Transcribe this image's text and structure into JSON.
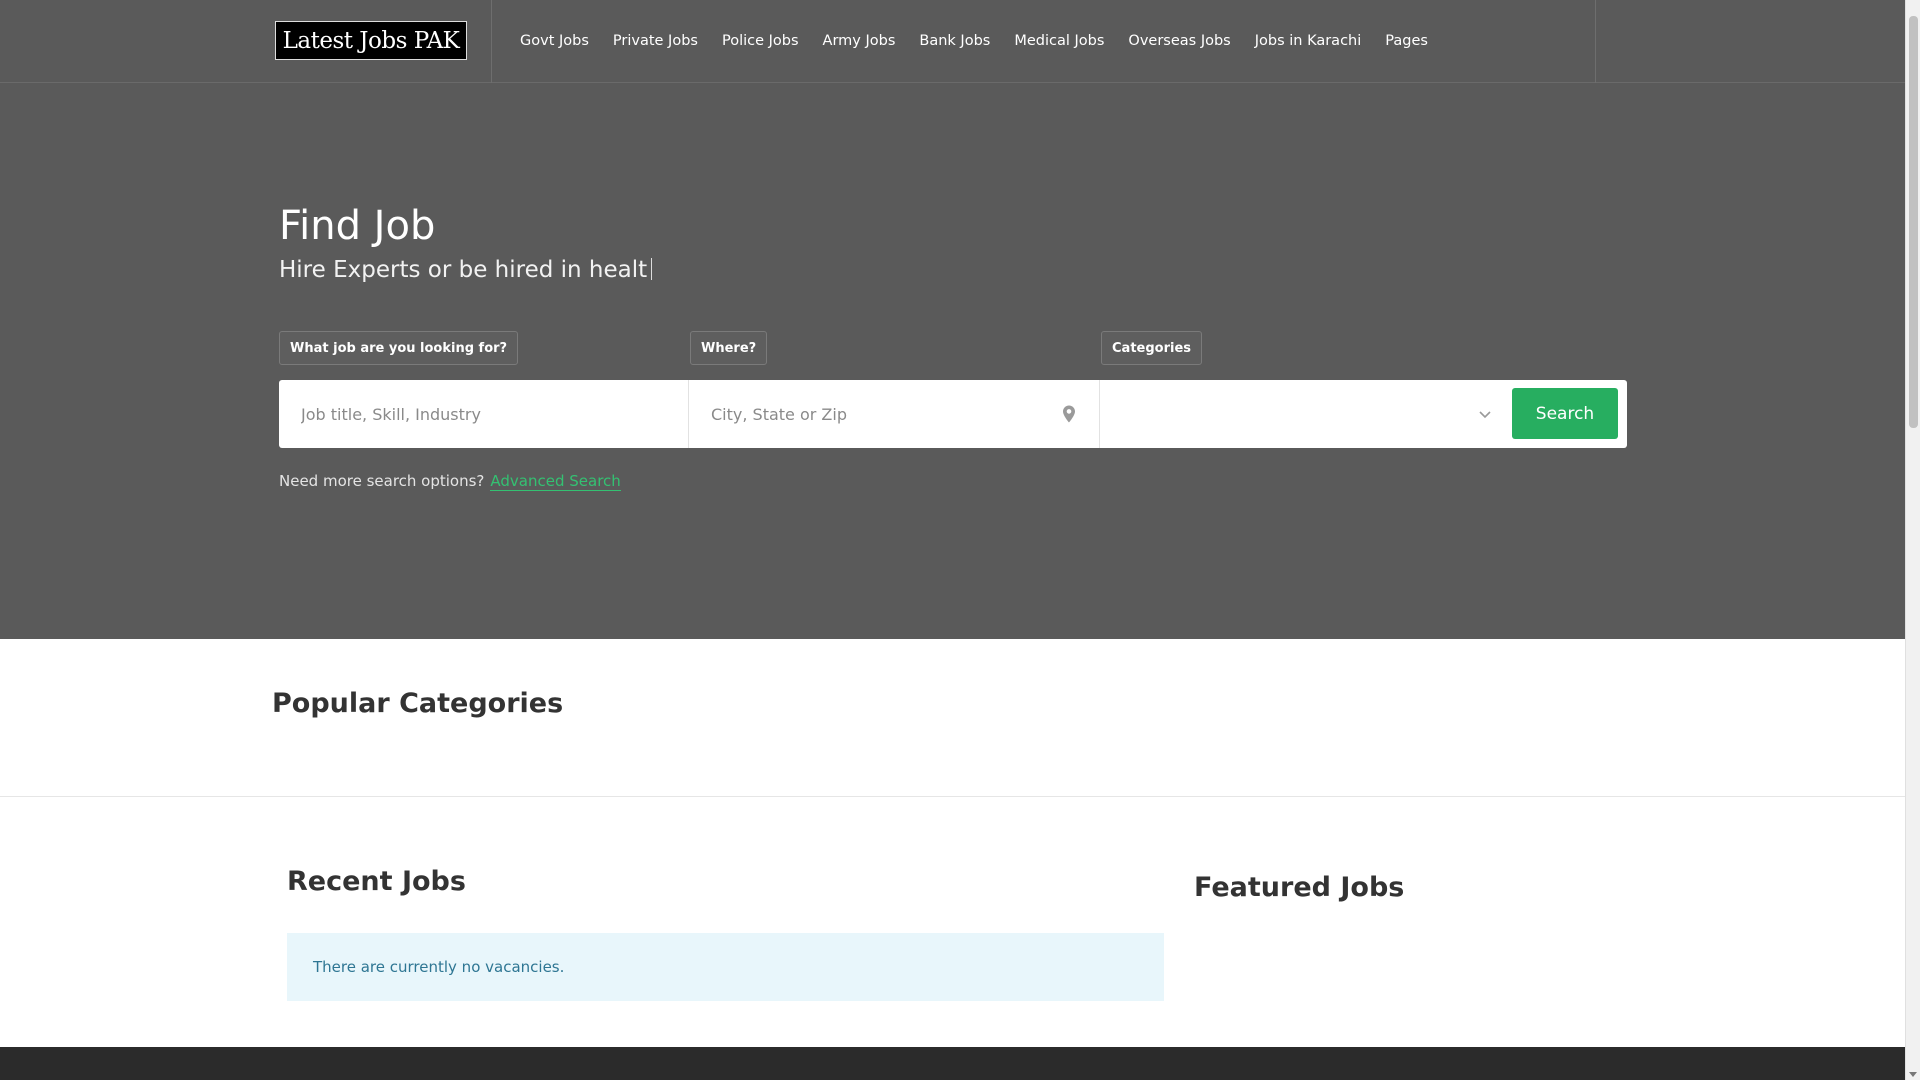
{
  "header": {
    "logo_text": "Latest Jobs PAK",
    "nav": [
      {
        "label": "Govt Jobs"
      },
      {
        "label": "Private Jobs"
      },
      {
        "label": "Police Jobs"
      },
      {
        "label": "Army Jobs"
      },
      {
        "label": "Bank Jobs"
      },
      {
        "label": "Medical Jobs"
      },
      {
        "label": "Overseas Jobs"
      },
      {
        "label": "Jobs in Karachi"
      },
      {
        "label": "Pages"
      }
    ]
  },
  "hero": {
    "title": "Find Job",
    "subtitle": "Hire Experts or be hired in healt",
    "tags": {
      "what": "What job are you looking for?",
      "where": "Where?",
      "categories": "Categories"
    },
    "search": {
      "keyword_placeholder": "Job title, Skill, Industry",
      "location_placeholder": "City, State or Zip",
      "category_value": "",
      "button_label": "Search"
    },
    "more_options_text": "Need more search options?",
    "advanced_link": "Advanced Search"
  },
  "sections": {
    "popular_title": "Popular Categories",
    "recent_title": "Recent Jobs",
    "recent_notice": "There are currently no vacancies.",
    "featured_title": "Featured Jobs"
  },
  "icons": {
    "location": "map-pin-icon",
    "dropdown": "chevron-down-icon"
  },
  "colors": {
    "hero_bg": "#5a5a5a",
    "accent": "#27ae60",
    "notice_bg": "#e8f6fb",
    "notice_text": "#2e7693"
  }
}
